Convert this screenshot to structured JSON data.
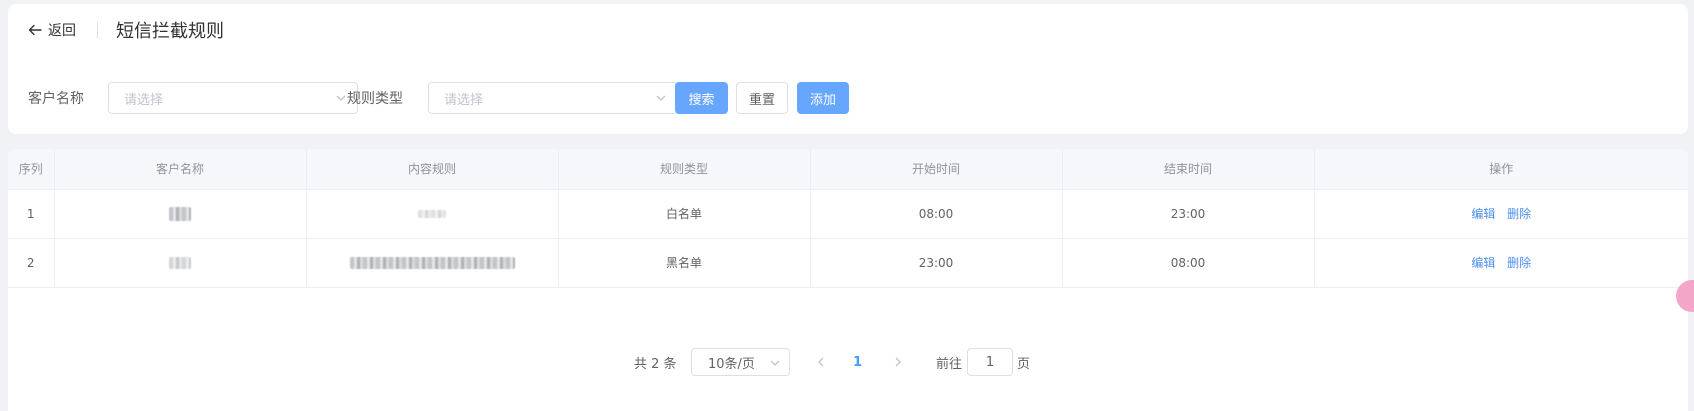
{
  "header": {
    "back_label": "返回",
    "title": "短信拦截规则"
  },
  "filters": {
    "customer_label": "客户名称",
    "customer_placeholder": "请选择",
    "rule_type_label": "规则类型",
    "rule_type_placeholder": "请选择",
    "search_button": "搜索",
    "reset_button": "重置",
    "add_button": "添加"
  },
  "table": {
    "columns": [
      "序列",
      "客户名称",
      "内容规则",
      "规则类型",
      "开始时间",
      "结束时间",
      "操作"
    ],
    "rows": [
      {
        "index": "1",
        "rule_type": "白名单",
        "start": "08:00",
        "end": "23:00",
        "edit": "编辑",
        "delete": "删除"
      },
      {
        "index": "2",
        "rule_type": "黑名单",
        "start": "23:00",
        "end": "08:00",
        "edit": "编辑",
        "delete": "删除"
      }
    ]
  },
  "pagination": {
    "total_text": "共 2 条",
    "page_size": "10条/页",
    "current_page": "1",
    "goto_label": "前往",
    "goto_value": "1",
    "page_suffix": "页"
  },
  "colors": {
    "primary": "#66a6ff",
    "link": "#4d8ff0",
    "active_page": "#409eff",
    "background": "#f0f2f5"
  },
  "icons": [
    "arrow-left-icon",
    "chevron-down-icon",
    "chevron-left-icon",
    "chevron-right-icon"
  ]
}
